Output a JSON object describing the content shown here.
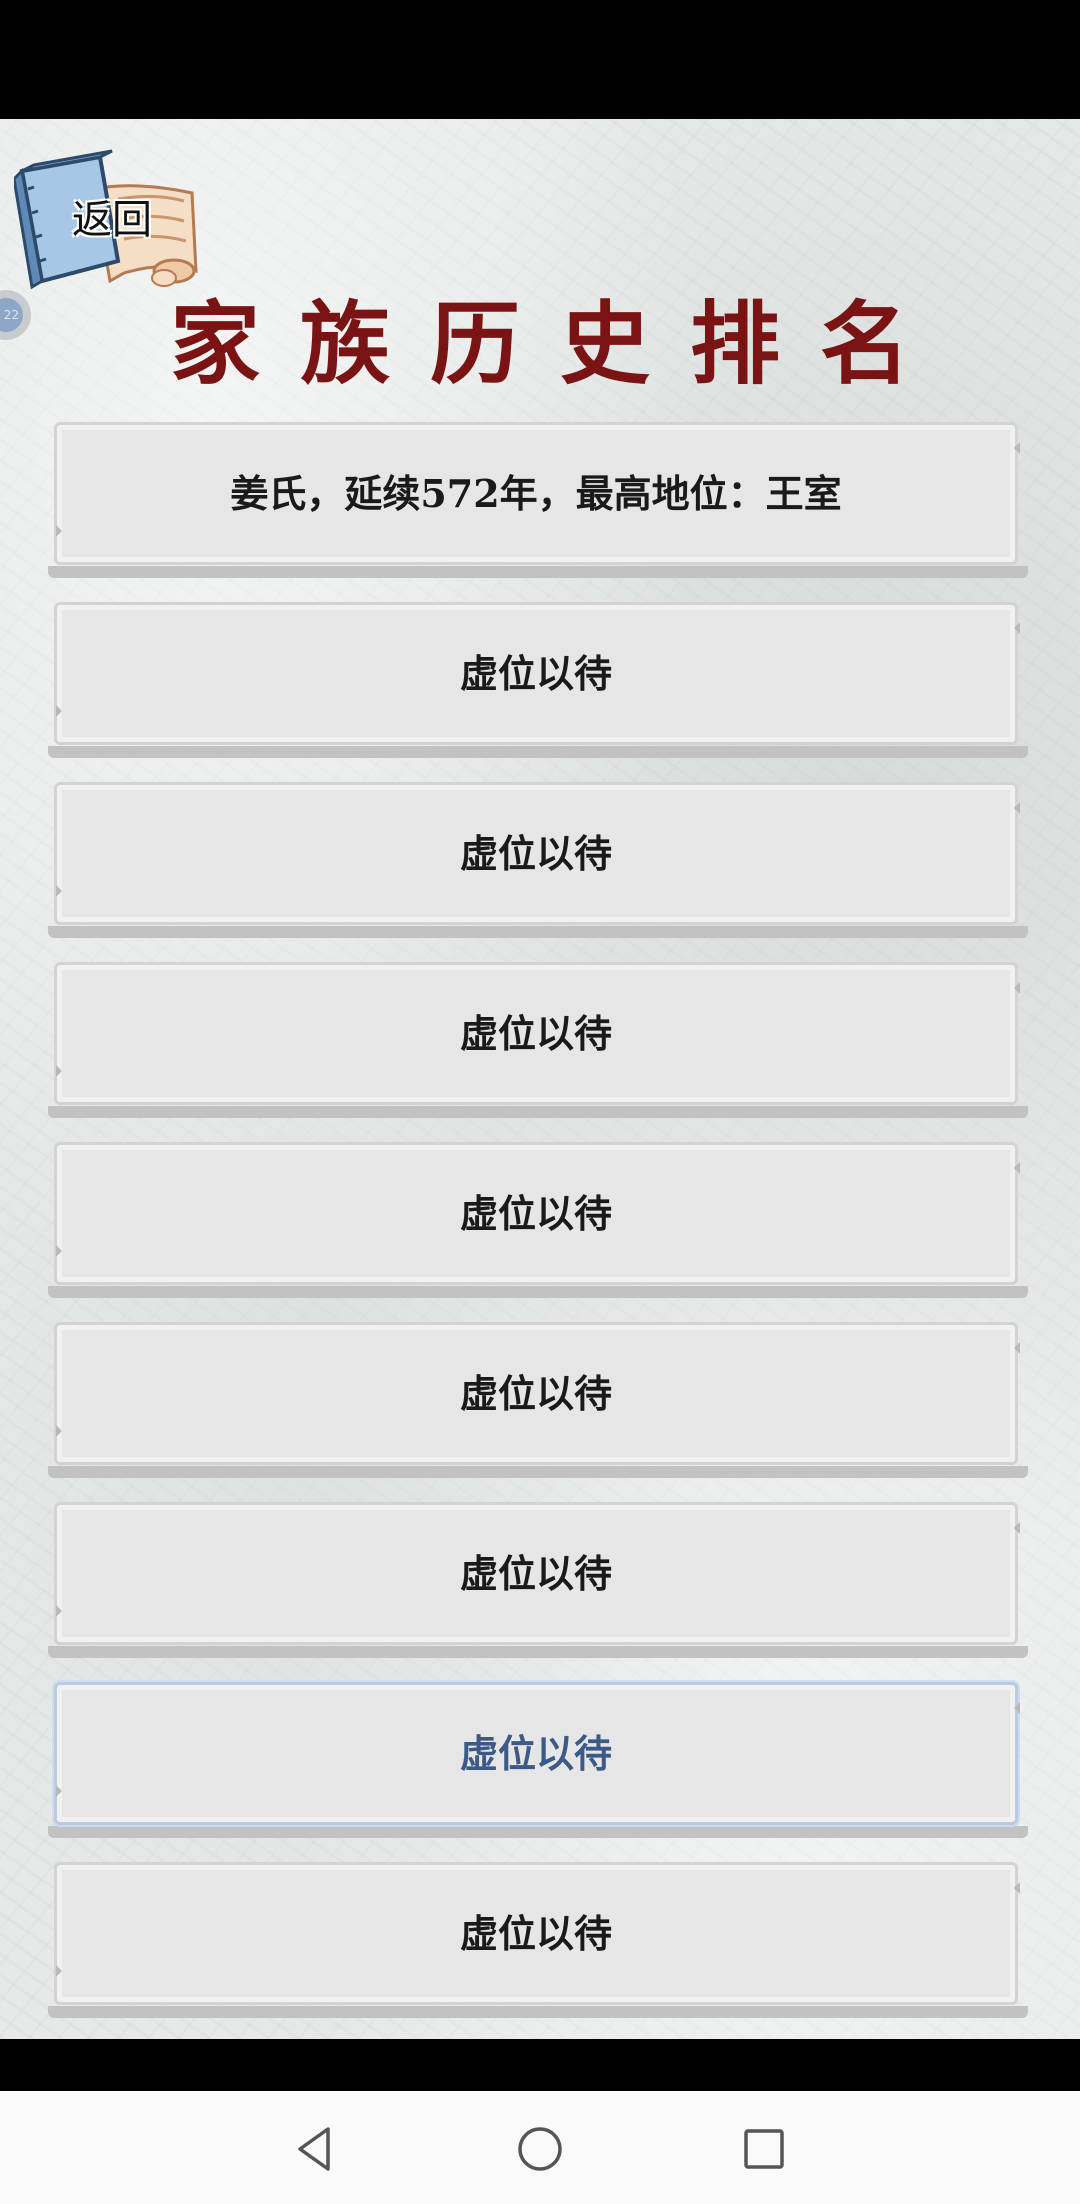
{
  "header": {
    "back_label": "返回",
    "title": "家族历史排名"
  },
  "rankings": [
    {
      "label": "姜氏，延续572年，最高地位：王室"
    },
    {
      "label": "虚位以待"
    },
    {
      "label": "虚位以待"
    },
    {
      "label": "虚位以待"
    },
    {
      "label": "虚位以待"
    },
    {
      "label": "虚位以待"
    },
    {
      "label": "虚位以待"
    },
    {
      "label": "虚位以待"
    },
    {
      "label": "虚位以待"
    }
  ],
  "selected_index": 7,
  "side_badge": {
    "text": "22"
  },
  "icons": {
    "back": "book-scroll-icon",
    "nav_back": "triangle-back-icon",
    "nav_home": "circle-home-icon",
    "nav_recent": "square-recent-icon"
  },
  "colors": {
    "title": "#7a1414",
    "selected_text": "#3b5a88",
    "card": "#e6e6e6"
  }
}
